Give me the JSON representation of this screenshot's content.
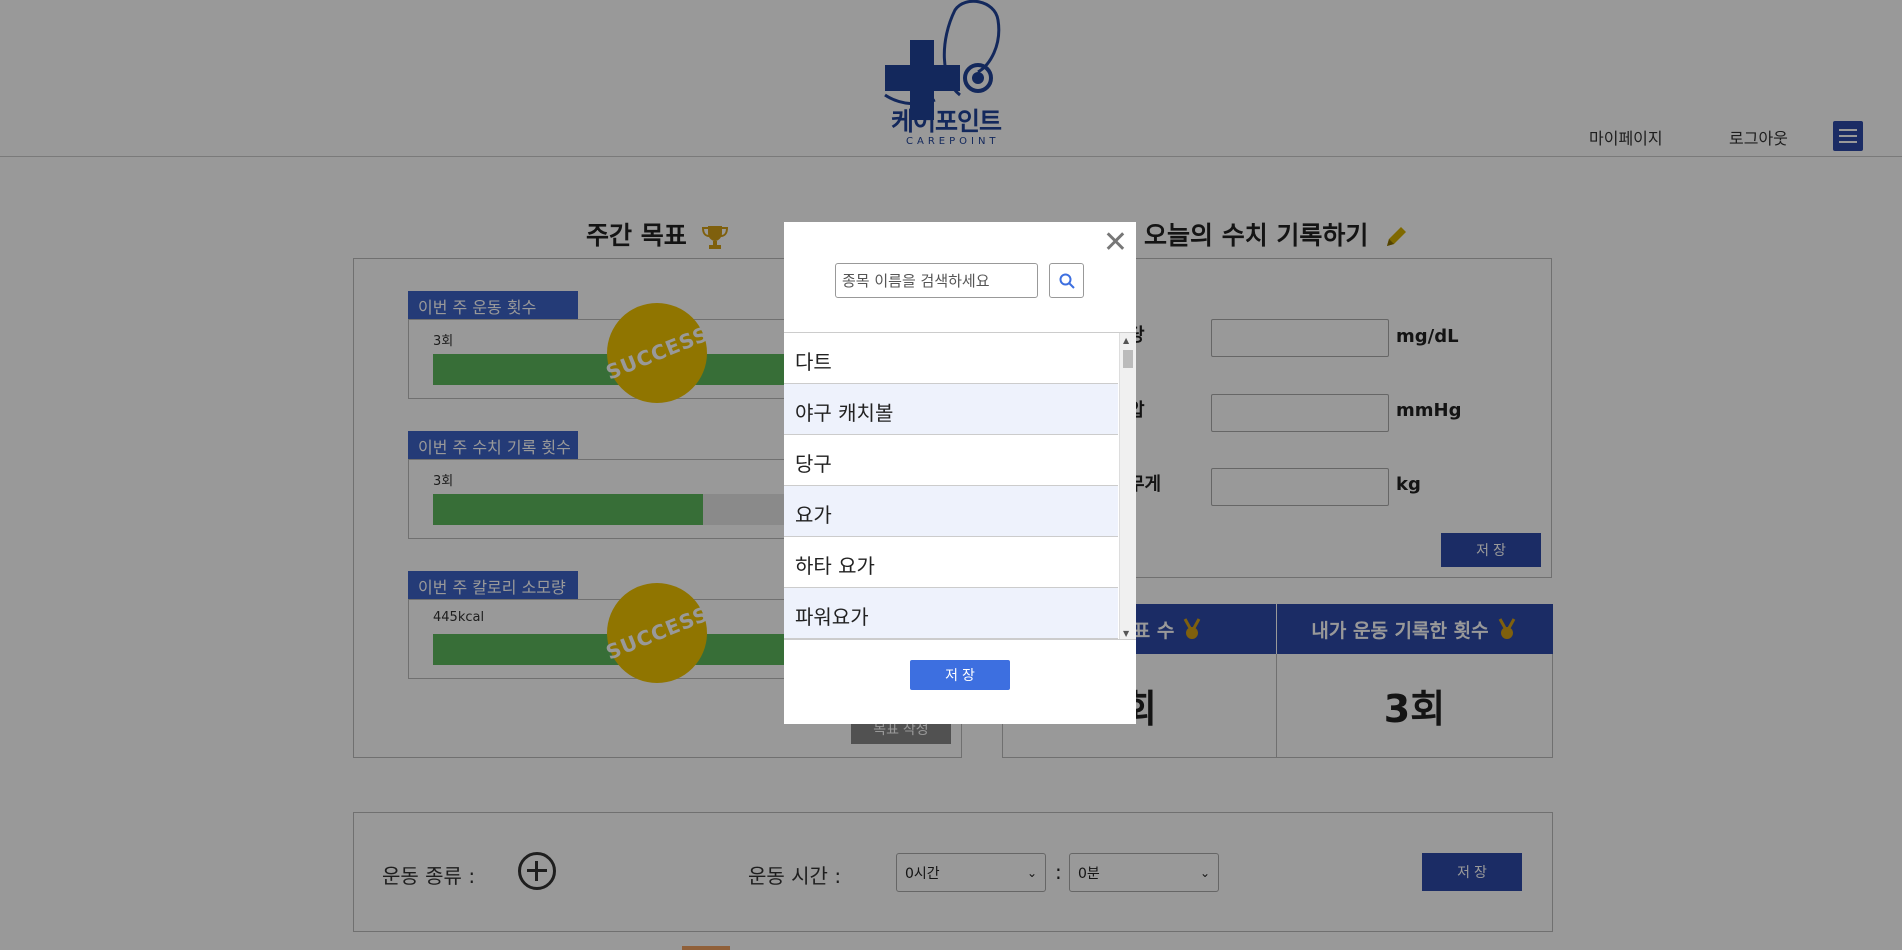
{
  "header": {
    "logo_text": "케어포인트",
    "logo_sub": "CAREPOINT",
    "mypage_label": "마이페이지",
    "logout_label": "로그아웃"
  },
  "weekly_goal": {
    "title": "주간 목표",
    "goals": [
      {
        "label": "이번 주 운동 횟수",
        "value": "3회",
        "progress": 1.0,
        "status": "SUCCESS"
      },
      {
        "label": "이번 주 수치 기록 횟수",
        "value": "3회",
        "progress": 0.5,
        "status": ""
      },
      {
        "label": "이번 주 칼로리 소모량",
        "value": "445kcal",
        "progress": 1.0,
        "status": "SUCCESS"
      }
    ],
    "edit_button": "목표 작성"
  },
  "today_record": {
    "title": "오늘의 수치 기록하기",
    "rows": [
      {
        "label": "당",
        "unit": "mg/dL"
      },
      {
        "label": "압",
        "unit": "mmHg"
      },
      {
        "label": "무게",
        "unit": "kg"
      }
    ],
    "save_button": "저 장"
  },
  "stats": {
    "headers": [
      "주간 목표 수",
      "내가 운동 기록한 횟수"
    ],
    "values": [
      "회",
      "3회"
    ]
  },
  "exercise_bar": {
    "type_label": "운동 종류 :",
    "time_label": "운동 시간 :",
    "hour_select": "0시간",
    "minute_select": "0분",
    "colon": ":",
    "save_button": "저 장"
  },
  "modal": {
    "search_placeholder": "종목 이름을 검색하세요",
    "items": [
      "다트",
      "야구 캐치볼",
      "당구",
      "요가",
      "하타 요가",
      "파워요가"
    ],
    "save_button": "저 장"
  },
  "colors": {
    "primary": "#2d4aa8",
    "accent": "#3d63c7",
    "progress": "#5cb85c",
    "stamp": "#f0c400"
  }
}
